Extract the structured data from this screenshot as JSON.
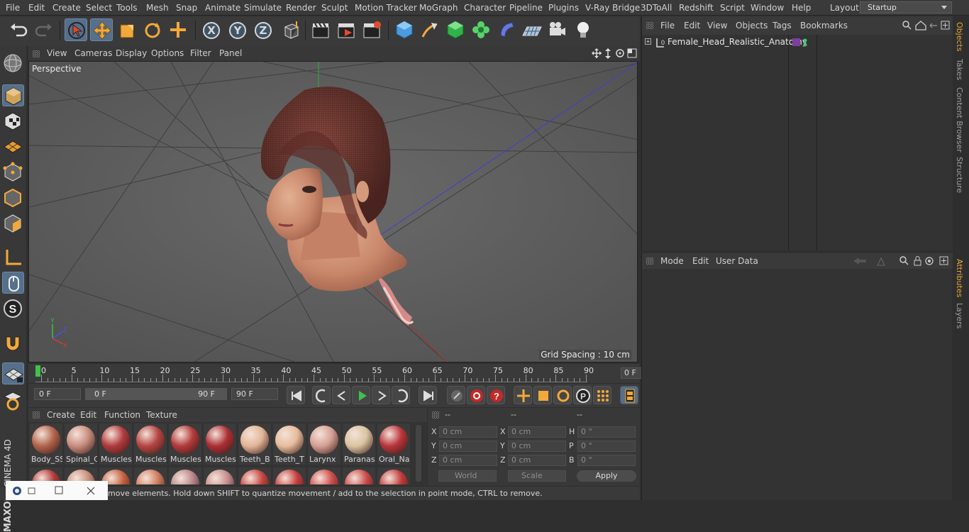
{
  "menubar": {
    "items": [
      "File",
      "Edit",
      "Create",
      "Select",
      "Tools",
      "Mesh",
      "Snap",
      "Animate",
      "Simulate",
      "Render",
      "Sculpt",
      "Motion Tracker",
      "MoGraph",
      "Character",
      "Pipeline",
      "Plugins",
      "V-Ray Bridge",
      "3DToAll",
      "Redshift",
      "Script",
      "Window",
      "Help"
    ],
    "layout_label": "Layout:",
    "layout_value": "Startup"
  },
  "toolbar": {
    "axis_x": "X",
    "axis_y": "Y",
    "axis_z": "Z"
  },
  "viewport": {
    "menu": [
      "View",
      "Cameras",
      "Display",
      "Options",
      "Filter",
      "Panel"
    ],
    "label": "Perspective",
    "grid_spacing": "Grid Spacing : 10 cm"
  },
  "timeline": {
    "ticks": [
      "0",
      "5",
      "10",
      "15",
      "20",
      "25",
      "30",
      "35",
      "40",
      "45",
      "50",
      "55",
      "60",
      "65",
      "70",
      "75",
      "80",
      "85",
      "90"
    ],
    "current_frame": "0 F"
  },
  "transport": {
    "start_frame": "0 F",
    "range_start": "0 F",
    "range_end": "90 F",
    "end_frame": "90 F"
  },
  "materials": {
    "menu": [
      "Create",
      "Edit",
      "Function",
      "Texture"
    ],
    "items": [
      {
        "label": "Body_SS",
        "color": "#b2644c"
      },
      {
        "label": "Spinal_C",
        "color": "#c88d7e"
      },
      {
        "label": "Muscles",
        "color": "#b13a3e"
      },
      {
        "label": "Muscles",
        "color": "#b54642"
      },
      {
        "label": "Muscles",
        "color": "#b33a3b"
      },
      {
        "label": "Muscles",
        "color": "#ac2f35"
      },
      {
        "label": "Teeth_B",
        "color": "#e2b597"
      },
      {
        "label": "Teeth_T",
        "color": "#e6bc9c"
      },
      {
        "label": "Larynx",
        "color": "#d59f94"
      },
      {
        "label": "Paranas",
        "color": "#d9c4a1"
      },
      {
        "label": "Oral_Na",
        "color": "#b8353b"
      }
    ],
    "row2_colors": [
      "#b43a3a",
      "#c98e7a",
      "#c56140",
      "#d07d5e",
      "#b8868b",
      "#c58e8e",
      "#c5453e",
      "#c43e3e",
      "#cf4d4d",
      "#c94a4a",
      "#c23a3a"
    ]
  },
  "coords": {
    "headers": [
      "--",
      "--",
      "--"
    ],
    "rows": [
      {
        "l1": "X",
        "v1": "0 cm",
        "l2": "X",
        "v2": "0 cm",
        "l3": "H",
        "v3": "0 °"
      },
      {
        "l1": "Y",
        "v1": "0 cm",
        "l2": "Y",
        "v2": "0 cm",
        "l3": "P",
        "v3": "0 °"
      },
      {
        "l1": "Z",
        "v1": "0 cm",
        "l2": "Z",
        "v2": "0 cm",
        "l3": "B",
        "v3": "0 °"
      }
    ],
    "world": "World",
    "scale": "Scale",
    "apply": "Apply"
  },
  "status": {
    "text": "move elements. Hold down SHIFT to quantize movement / add to the selection in point mode, CTRL to remove."
  },
  "objects": {
    "menu": [
      "File",
      "Edit",
      "View",
      "Objects",
      "Tags",
      "Bookmarks"
    ],
    "tree_item": "Female_Head_Realistic_Anatomy",
    "tag_color": "#7a3fa0"
  },
  "attributes": {
    "menu": [
      "Mode",
      "Edit",
      "User Data"
    ]
  },
  "side_tabs": [
    "Objects",
    "Takes",
    "Content Browser",
    "Structure",
    "Attributes",
    "Layers"
  ],
  "logo": {
    "text1": "MAXON",
    "text2": "CINEMA 4D"
  }
}
